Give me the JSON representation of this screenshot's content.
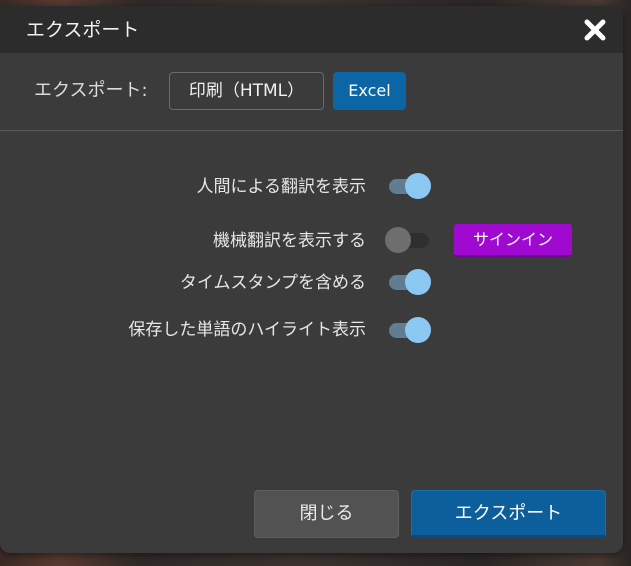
{
  "dialog": {
    "title": "エクスポート",
    "close_icon": "close-x-icon"
  },
  "format": {
    "label": "エクスポート:",
    "options": [
      {
        "label": "印刷（HTML）",
        "selected": false
      },
      {
        "label": "Excel",
        "selected": true
      }
    ]
  },
  "options": [
    {
      "label": "人間による翻訳を表示",
      "enabled": true
    },
    {
      "label": "機械翻訳を表示する",
      "enabled": false
    },
    {
      "label": "タイムスタンプを含める",
      "enabled": true
    },
    {
      "label": "保存した単語のハイライト表示",
      "enabled": true
    }
  ],
  "signin": {
    "label": "サインイン"
  },
  "footer": {
    "close_label": "閉じる",
    "export_label": "エクスポート"
  },
  "colors": {
    "accent_blue": "#0c66a6",
    "signin_purple": "#a00ad0",
    "toggle_on_knob": "#8cc8f4"
  }
}
